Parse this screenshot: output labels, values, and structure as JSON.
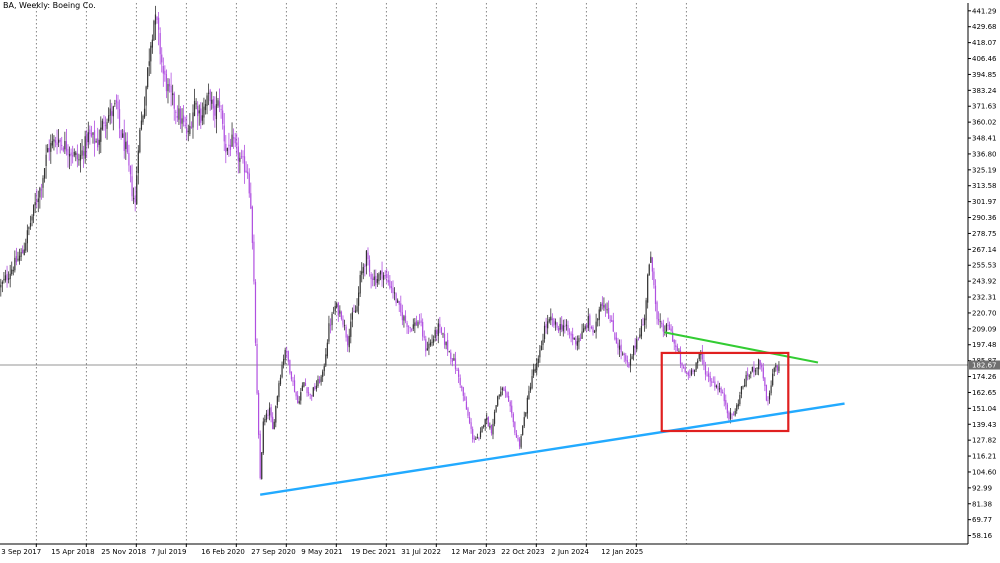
{
  "chart_data": {
    "type": "candlestick",
    "title": "BA, Weekly: Boeing Co.",
    "colors": {
      "up": "#333333",
      "down": "#b050e0",
      "support_line": "#22aaff",
      "resistance_line": "#33cc33",
      "highlight_box": "#e02020",
      "current_price_line": "#707070",
      "grid": "#555555"
    },
    "ylim": [
      52.0,
      447.0
    ],
    "y_ticks": [
      "441.29",
      "429.68",
      "418.07",
      "406.46",
      "394.85",
      "383.24",
      "371.63",
      "360.02",
      "348.41",
      "336.80",
      "325.19",
      "313.58",
      "301.97",
      "290.36",
      "278.75",
      "267.14",
      "255.53",
      "243.92",
      "232.31",
      "220.70",
      "209.09",
      "197.48",
      "185.87",
      "174.26",
      "162.65",
      "151.04",
      "139.43",
      "127.82",
      "116.21",
      "104.60",
      "92.99",
      "81.38",
      "69.77",
      "58.16"
    ],
    "current_price": "182.67",
    "x_labels": [
      "3 Sep 2017",
      "15 Apr 2018",
      "25 Nov 2018",
      "7 Jul 2019",
      "16 Feb 2020",
      "27 Sep 2020",
      "9 May 2021",
      "19 Dec 2021",
      "31 Jul 2022",
      "12 Mar 2023",
      "22 Oct 2023",
      "2 Jun 2024",
      "12 Jan 2025"
    ],
    "weeks_per_label": 32,
    "price_path": [
      [
        0,
        240
      ],
      [
        8,
        255
      ],
      [
        14,
        265
      ],
      [
        22,
        300
      ],
      [
        26,
        315
      ],
      [
        30,
        340
      ],
      [
        36,
        348
      ],
      [
        44,
        340
      ],
      [
        50,
        332
      ],
      [
        56,
        350
      ],
      [
        62,
        345
      ],
      [
        66,
        362
      ],
      [
        72,
        368
      ],
      [
        74,
        372
      ],
      [
        76,
        355
      ],
      [
        80,
        340
      ],
      [
        82,
        325
      ],
      [
        84,
        310
      ],
      [
        86,
        300
      ],
      [
        88,
        345
      ],
      [
        92,
        375
      ],
      [
        96,
        420
      ],
      [
        98,
        435
      ],
      [
        100,
        430
      ],
      [
        104,
        395
      ],
      [
        108,
        380
      ],
      [
        112,
        370
      ],
      [
        116,
        360
      ],
      [
        120,
        350
      ],
      [
        124,
        375
      ],
      [
        128,
        365
      ],
      [
        134,
        380
      ],
      [
        136,
        365
      ],
      [
        140,
        375
      ],
      [
        144,
        340
      ],
      [
        148,
        345
      ],
      [
        150,
        340
      ],
      [
        154,
        330
      ],
      [
        158,
        325
      ],
      [
        160,
        300
      ],
      [
        162,
        240
      ],
      [
        164,
        160
      ],
      [
        166,
        100
      ],
      [
        168,
        140
      ],
      [
        172,
        150
      ],
      [
        174,
        135
      ],
      [
        178,
        170
      ],
      [
        182,
        195
      ],
      [
        186,
        175
      ],
      [
        190,
        155
      ],
      [
        194,
        170
      ],
      [
        198,
        160
      ],
      [
        202,
        168
      ],
      [
        206,
        175
      ],
      [
        210,
        210
      ],
      [
        214,
        225
      ],
      [
        218,
        220
      ],
      [
        222,
        200
      ],
      [
        224,
        215
      ],
      [
        228,
        225
      ],
      [
        230,
        245
      ],
      [
        232,
        255
      ],
      [
        234,
        262
      ],
      [
        236,
        250
      ],
      [
        240,
        245
      ],
      [
        244,
        250
      ],
      [
        250,
        240
      ],
      [
        256,
        220
      ],
      [
        262,
        210
      ],
      [
        268,
        215
      ],
      [
        272,
        195
      ],
      [
        276,
        200
      ],
      [
        280,
        210
      ],
      [
        286,
        195
      ],
      [
        290,
        185
      ],
      [
        294,
        170
      ],
      [
        298,
        150
      ],
      [
        302,
        130
      ],
      [
        306,
        128
      ],
      [
        310,
        145
      ],
      [
        314,
        135
      ],
      [
        318,
        160
      ],
      [
        322,
        165
      ],
      [
        326,
        150
      ],
      [
        330,
        130
      ],
      [
        332,
        125
      ],
      [
        336,
        150
      ],
      [
        340,
        175
      ],
      [
        344,
        185
      ],
      [
        348,
        210
      ],
      [
        352,
        215
      ],
      [
        356,
        210
      ],
      [
        360,
        212
      ],
      [
        364,
        205
      ],
      [
        368,
        200
      ],
      [
        372,
        205
      ],
      [
        376,
        215
      ],
      [
        380,
        205
      ],
      [
        384,
        230
      ],
      [
        388,
        225
      ],
      [
        390,
        215
      ],
      [
        394,
        200
      ],
      [
        398,
        190
      ],
      [
        402,
        180
      ],
      [
        404,
        190
      ],
      [
        408,
        205
      ],
      [
        412,
        215
      ],
      [
        414,
        250
      ],
      [
        416,
        258
      ],
      [
        418,
        245
      ],
      [
        420,
        215
      ],
      [
        424,
        208
      ],
      [
        428,
        210
      ],
      [
        432,
        195
      ],
      [
        434,
        190
      ],
      [
        436,
        180
      ],
      [
        440,
        175
      ],
      [
        444,
        182
      ],
      [
        448,
        190
      ],
      [
        452,
        175
      ],
      [
        456,
        170
      ],
      [
        460,
        165
      ],
      [
        464,
        155
      ],
      [
        466,
        145
      ],
      [
        470,
        148
      ],
      [
        474,
        165
      ],
      [
        478,
        175
      ],
      [
        482,
        180
      ],
      [
        486,
        185
      ],
      [
        488,
        175
      ],
      [
        490,
        155
      ],
      [
        492,
        160
      ],
      [
        494,
        175
      ],
      [
        496,
        182
      ],
      [
        498,
        180
      ]
    ],
    "support_line": {
      "x1": 166,
      "y1": 88.0,
      "x2": 540,
      "y2": 154.5
    },
    "resistance_line": {
      "x1": 425,
      "y1": 206.5,
      "x2": 523,
      "y2": 184.5
    },
    "highlight_box": {
      "x1": 423,
      "x2": 504,
      "y1": 191.5,
      "y2": 134.5
    }
  }
}
